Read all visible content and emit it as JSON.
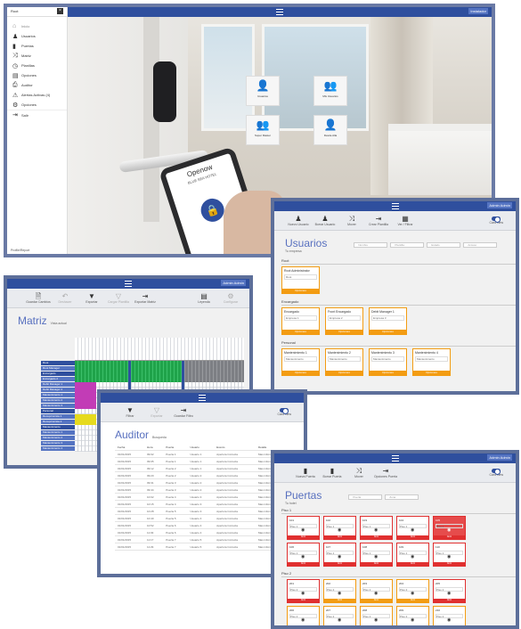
{
  "hero": {
    "user": "Root",
    "topbar_user": "Instalador",
    "brand": "Openow",
    "hotel": "BLUE SEA HOTEL",
    "footer_user": "Profile/Report",
    "menu": [
      "Inicio",
      "Usuarios",
      "Puertas",
      "Matriz",
      "Planillas",
      "Opciones",
      "Auditor",
      "Alertas Activas (4)",
      "Opciones",
      "Salir"
    ],
    "tiles": [
      "Usuarios",
      "Mis Usuarios",
      "Super Master",
      "Desde Alla"
    ]
  },
  "usuarios": {
    "username": "Admin Admin",
    "title": "Usuarios",
    "subtitle": "Tu empresa",
    "toolbar": [
      "Nuevo Usuario",
      "Borrar Usuario",
      "Mover",
      "Crear Plantilla",
      "Ver / Filtrar"
    ],
    "toggle": "Card view",
    "filters": [
      "Nombre",
      "Plantilla",
      "Estado",
      "Acceso"
    ],
    "sections": [
      {
        "title": "Root",
        "cards": [
          {
            "name": "Root Administrator",
            "field": "Root"
          }
        ]
      },
      {
        "title": "Encargado",
        "cards": [
          {
            "name": "Encargado",
            "field": "Empresa 1"
          },
          {
            "name": "Front Encargado",
            "field": "Empresa 2"
          },
          {
            "name": "Debit Manager 1",
            "field": "Empresa 3"
          }
        ]
      },
      {
        "title": "Personal",
        "cards": [
          {
            "name": "Mantenimiento 1",
            "field": "Mantenimiento"
          },
          {
            "name": "Mantenimiento 2",
            "field": "Mantenimiento"
          },
          {
            "name": "Mantenimiento 3",
            "field": "Mantenimiento"
          },
          {
            "name": "Mantenimiento 4",
            "field": "Mantenimiento"
          }
        ]
      }
    ],
    "card_footer": "Opciones"
  },
  "matriz": {
    "username": "Admin Admin",
    "title": "Matriz",
    "subtitle": "Vista actual",
    "toolbar": [
      "Guardar Cambios",
      "Deshacer",
      "Exportar",
      "Cargar Plantilla",
      "Exportar Matriz"
    ],
    "toolbar_right": [
      "Leyenda",
      "Configurar"
    ],
    "rows": [
      "Root",
      "Root Manager",
      "Encargado",
      "Encargado 2",
      "Debit Manager 1",
      "Debit Manager 2",
      "Mantenimiento 1",
      "Mantenimiento 2",
      "Mantenimiento 3",
      "Personal",
      "Recepcionista 1",
      "Recepcionista 2",
      "Mantenimiento",
      "Mantenimiento 1",
      "Mantenimiento 2",
      "Mantenimiento 3",
      "Mantenimiento 4"
    ]
  },
  "auditor": {
    "title": "Auditor",
    "subtitle": "Busqueda",
    "toolbar": [
      "Filtrar",
      "Exportar",
      "Guardar Filtro"
    ],
    "toggle": "Card view",
    "headers": [
      "Fecha",
      "Hora",
      "Puerta",
      "Usuario",
      "Evento",
      "Detalle"
    ],
    "rows": [
      [
        "01/01/2015",
        "09:02",
        "Puerta 1",
        "Usuario 1",
        "Apertura Correcta",
        "Mas informacion"
      ],
      [
        "01/01/2015",
        "09:05",
        "Puerta 1",
        "Usuario 1",
        "Apertura Correcta",
        "Mas informacion"
      ],
      [
        "01/01/2015",
        "09:12",
        "Puerta 2",
        "Usuario 1",
        "Apertura Correcta",
        "Mas informacion"
      ],
      [
        "01/01/2015",
        "09:20",
        "Puerta 2",
        "Usuario 2",
        "Apertura Correcta",
        "Mas informacion"
      ],
      [
        "01/01/2015",
        "09:31",
        "Puerta 3",
        "Usuario 2",
        "Apertura Correcta",
        "Mas informacion"
      ],
      [
        "01/01/2015",
        "09:44",
        "Puerta 3",
        "Usuario 2",
        "Apertura Correcta",
        "Mas informacion"
      ],
      [
        "01/01/2015",
        "10:02",
        "Puerta 4",
        "Usuario 3",
        "Apertura Correcta",
        "Mas informacion"
      ],
      [
        "01/01/2015",
        "10:15",
        "Puerta 4",
        "Usuario 3",
        "Apertura Correcta",
        "Mas informacion"
      ],
      [
        "01/01/2015",
        "10:28",
        "Puerta 5",
        "Usuario 3",
        "Apertura Correcta",
        "Mas informacion"
      ],
      [
        "01/01/2015",
        "10:40",
        "Puerta 5",
        "Usuario 4",
        "Apertura Correcta",
        "Mas informacion"
      ],
      [
        "01/01/2015",
        "10:52",
        "Puerta 6",
        "Usuario 4",
        "Apertura Correcta",
        "Mas informacion"
      ],
      [
        "01/01/2015",
        "11:03",
        "Puerta 6",
        "Usuario 4",
        "Apertura Correcta",
        "Mas informacion"
      ],
      [
        "01/01/2015",
        "11:17",
        "Puerta 7",
        "Usuario 5",
        "Apertura Correcta",
        "Mas informacion"
      ],
      [
        "01/01/2015",
        "11:29",
        "Puerta 7",
        "Usuario 5",
        "Apertura Correcta",
        "Mas informacion"
      ]
    ]
  },
  "puertas": {
    "username": "Admin Admin",
    "title": "Puertas",
    "subtitle": "Tu hotel",
    "toolbar": [
      "Nueva Puerta",
      "Borrar Puerta",
      "Mover",
      "Opciones Puerta"
    ],
    "toggle": "Card view",
    "filters": [
      "Puerta",
      "Zona"
    ],
    "floors": [
      {
        "title": "Piso 1",
        "doors": [
          {
            "name": "101",
            "zone": "Piso 1",
            "style": "red"
          },
          {
            "name": "102",
            "zone": "Piso 1",
            "style": "red"
          },
          {
            "name": "103",
            "zone": "Piso 1",
            "style": "red"
          },
          {
            "name": "104",
            "zone": "Piso 1",
            "style": "red"
          },
          {
            "name": "105",
            "zone": "Piso 1",
            "style": "filled"
          },
          {
            "name": "106",
            "zone": "Piso 1",
            "style": "red"
          },
          {
            "name": "107",
            "zone": "Piso 1",
            "style": "red"
          },
          {
            "name": "108",
            "zone": "Piso 1",
            "style": "red"
          },
          {
            "name": "109",
            "zone": "Piso 1",
            "style": "red"
          },
          {
            "name": "110",
            "zone": "Piso 1",
            "style": "red"
          }
        ]
      },
      {
        "title": "Piso 2",
        "doors": [
          {
            "name": "201",
            "zone": "Piso 2",
            "style": "red"
          },
          {
            "name": "202",
            "zone": "Piso 2",
            "style": "orange"
          },
          {
            "name": "203",
            "zone": "Piso 2",
            "style": "orange"
          },
          {
            "name": "204",
            "zone": "Piso 2",
            "style": "orange"
          },
          {
            "name": "205",
            "zone": "Piso 2",
            "style": "red"
          },
          {
            "name": "206",
            "zone": "Piso 2",
            "style": "orange"
          },
          {
            "name": "207",
            "zone": "Piso 2",
            "style": "orange"
          },
          {
            "name": "208",
            "zone": "Piso 2",
            "style": "orange"
          },
          {
            "name": "209",
            "zone": "Piso 2",
            "style": "orange"
          },
          {
            "name": "210",
            "zone": "Piso 2",
            "style": "orange"
          }
        ]
      }
    ],
    "door_footer": "Abrir"
  }
}
